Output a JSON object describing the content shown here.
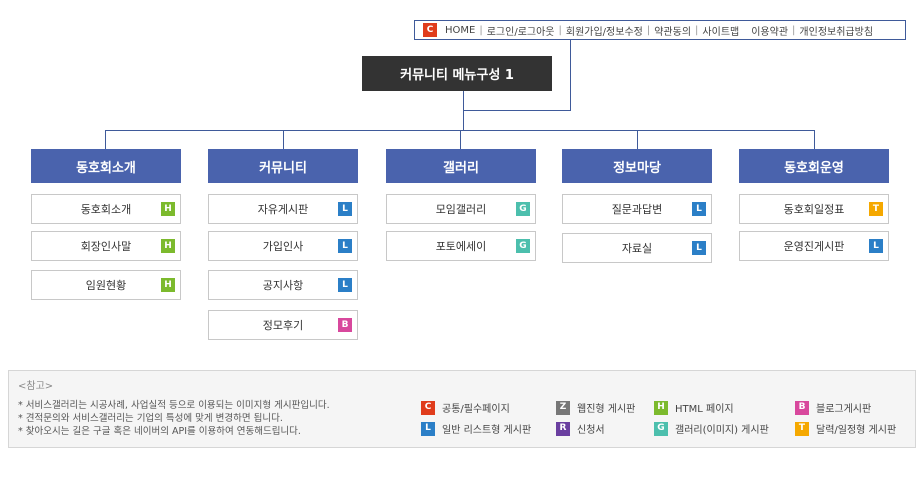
{
  "colors": {
    "C": "#e03c1c",
    "H": "#7cba2d",
    "L": "#2b7fc7",
    "G": "#4cbfad",
    "T": "#f5a800",
    "B": "#d8489d",
    "Z": "#777777",
    "R": "#6a3fa0"
  },
  "topbar": {
    "badge": "C",
    "links": [
      "HOME",
      "로그인/로그아웃",
      "회원가입/정보수정",
      "약관동의",
      "사이트맵",
      "이용약관",
      "개인정보취급방침"
    ]
  },
  "root": {
    "title": "커뮤니티 메뉴구성 1"
  },
  "columns": [
    {
      "title": "동호회소개",
      "items": [
        {
          "label": "동호회소개",
          "badge": "H"
        },
        {
          "label": "회장인사말",
          "badge": "H"
        },
        {
          "label": "임원현황",
          "badge": "H"
        }
      ]
    },
    {
      "title": "커뮤니티",
      "items": [
        {
          "label": "자유게시판",
          "badge": "L"
        },
        {
          "label": "가입인사",
          "badge": "L"
        },
        {
          "label": "공지사항",
          "badge": "L"
        },
        {
          "label": "정모후기",
          "badge": "B"
        }
      ]
    },
    {
      "title": "갤러리",
      "items": [
        {
          "label": "모임갤러리",
          "badge": "G"
        },
        {
          "label": "포토에세이",
          "badge": "G"
        }
      ]
    },
    {
      "title": "정보마당",
      "items": [
        {
          "label": "질문과답변",
          "badge": "L"
        },
        {
          "label": "자료실",
          "badge": "L"
        }
      ]
    },
    {
      "title": "동호회운영",
      "items": [
        {
          "label": "동호회일정표",
          "badge": "T"
        },
        {
          "label": "운영진게시판",
          "badge": "L"
        }
      ]
    }
  ],
  "note": {
    "title": "<참고>",
    "lines": [
      "* 서비스갤러리는 시공사례, 사업실적 등으로 이용되는 이미지형 게시판입니다.",
      "* 견적문의와 서비스갤러리는 기업의 특성에 맞게 변경하면 됩니다.",
      "* 찾아오시는 길은 구글 혹은 네이버의 API를 이용하여 연동해드립니다."
    ],
    "legend": [
      {
        "badge": "C",
        "label": "공통/필수페이지"
      },
      {
        "badge": "Z",
        "label": "웹진형 게시판"
      },
      {
        "badge": "H",
        "label": "HTML 페이지"
      },
      {
        "badge": "B",
        "label": "블로그게시판"
      },
      {
        "badge": "L",
        "label": "일반 리스트형 게시판"
      },
      {
        "badge": "R",
        "label": "신청서"
      },
      {
        "badge": "G",
        "label": "갤러리(이미지) 게시판"
      },
      {
        "badge": "T",
        "label": "달력/일정형 게시판"
      }
    ]
  }
}
